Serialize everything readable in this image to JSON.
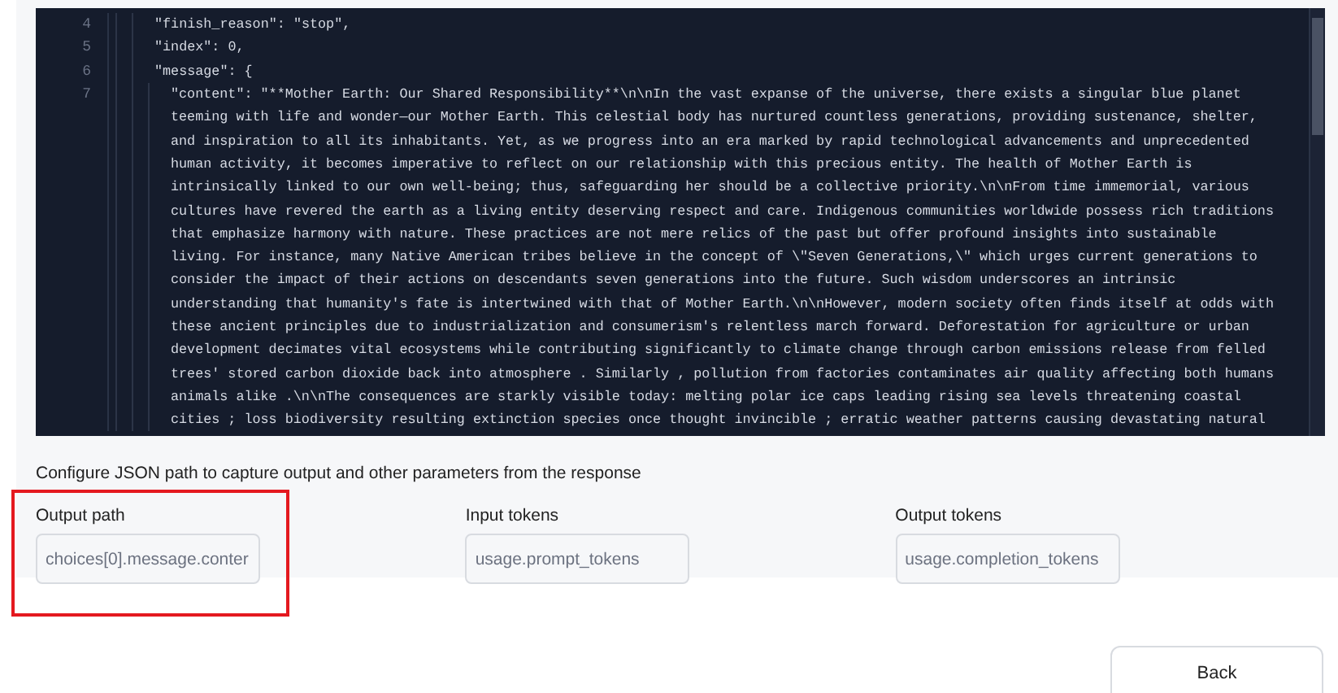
{
  "editor": {
    "lines": [
      {
        "number": "4",
        "segments": [
          "\"finish_reason\": \"stop\","
        ]
      },
      {
        "number": "5",
        "segments": [
          "\"index\": 0,"
        ]
      },
      {
        "number": "6",
        "segments": [
          "\"message\": {"
        ],
        "children": [
          {
            "number": "7",
            "segments": [
              "\"content\": \"**Mother Earth: Our Shared Responsibility**\\n\\nIn the vast expanse of the universe, there exists a singular blue planet",
              "teeming with life and wonder—our Mother Earth. This celestial body has nurtured countless generations, providing sustenance, shelter,",
              "and inspiration to all its inhabitants. Yet, as we progress into an era marked by rapid technological advancements and unprecedented",
              "human activity, it becomes imperative to reflect on our relationship with this precious entity. The health of Mother Earth is",
              "intrinsically linked to our own well-being; thus, safeguarding her should be a collective priority.\\n\\nFrom time immemorial, various",
              "cultures have revered the earth as a living entity deserving respect and care. Indigenous communities worldwide possess rich traditions",
              "that emphasize harmony with nature. These practices are not mere relics of the past but offer profound insights into sustainable",
              "living. For instance, many Native American tribes believe in the concept of \\\"Seven Generations,\\\" which urges current generations to",
              "consider the impact of their actions on descendants seven generations into the future. Such wisdom underscores an intrinsic",
              "understanding that humanity's fate is intertwined with that of Mother Earth.\\n\\nHowever, modern society often finds itself at odds with",
              "these ancient principles due to industrialization and consumerism's relentless march forward. Deforestation for agriculture or urban",
              "development decimates vital ecosystems while contributing significantly to climate change through carbon emissions release from felled",
              "trees' stored carbon dioxide back into atmosphere . Similarly , pollution from factories contaminates air quality affecting both humans",
              "animals alike .\\n\\nThe consequences are starkly visible today: melting polar ice caps leading rising sea levels threatening coastal",
              "cities ; loss biodiversity resulting extinction species once thought invincible ; erratic weather patterns causing devastating natural"
            ]
          }
        ]
      }
    ]
  },
  "config": {
    "heading": "Configure JSON path to capture output and other parameters from the response",
    "fields": [
      {
        "label": "Output path",
        "placeholder": "choices[0].message.conter",
        "highlighted": true
      },
      {
        "label": "Input tokens",
        "placeholder": "usage.prompt_tokens",
        "highlighted": false
      },
      {
        "label": "Output tokens",
        "placeholder": "usage.completion_tokens",
        "highlighted": false
      }
    ]
  },
  "buttons": [
    {
      "label": "Back"
    }
  ]
}
